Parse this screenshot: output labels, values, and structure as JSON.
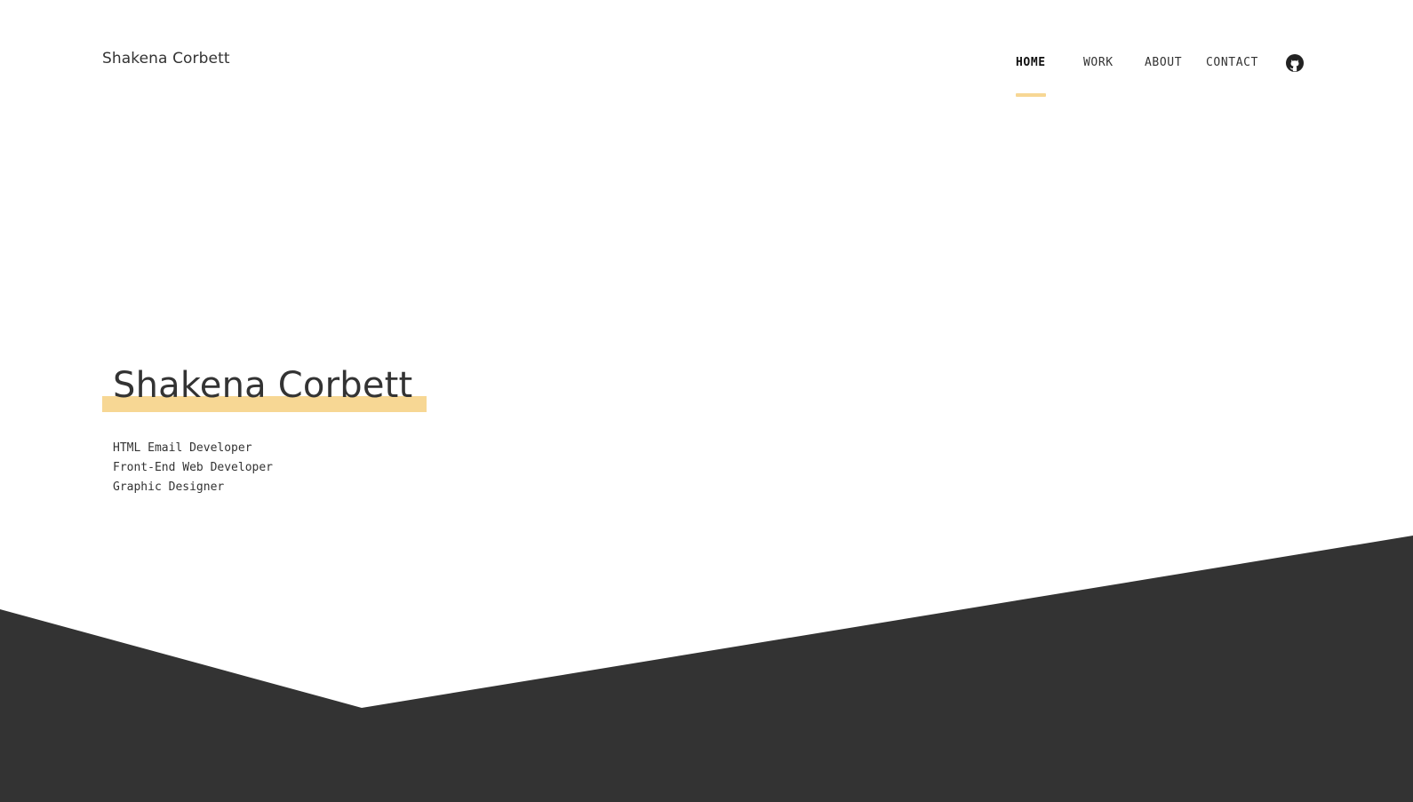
{
  "header": {
    "brand": "Shakena Corbett",
    "nav": [
      {
        "label": "HOME",
        "active": true
      },
      {
        "label": "WORK",
        "active": false
      },
      {
        "label": "ABOUT",
        "active": false
      },
      {
        "label": "CONTACT",
        "active": false
      }
    ],
    "social_icon": "github-icon"
  },
  "hero": {
    "title": "Shakena Corbett",
    "roles": [
      "HTML Email Developer",
      "Front-End Web Developer",
      "Graphic Designer"
    ]
  },
  "colors": {
    "accent": "#f7d794",
    "text": "#333333",
    "dark_band": "#333333",
    "background": "#ffffff"
  }
}
